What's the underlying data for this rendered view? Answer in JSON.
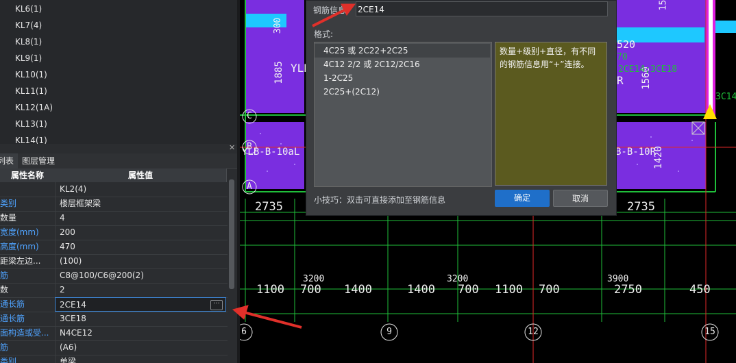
{
  "beam_list": [
    "KL6(1)",
    "KL7(4)",
    "KL8(1)",
    "KL9(1)",
    "KL10(1)",
    "KL11(1)",
    "KL12(1A)",
    "KL13(1)",
    "KL14(1)"
  ],
  "tabs": {
    "property_list": "属性列表",
    "layer_manage": "图层管理"
  },
  "props": {
    "header_name": "属性名称",
    "header_value": "属性值",
    "rows": [
      {
        "name": "名称",
        "value": "KL2(4)"
      },
      {
        "name": "结构类别",
        "value": "楼层框架梁"
      },
      {
        "name": "跨数量",
        "value": "4"
      },
      {
        "name": "截面宽度(mm)",
        "value": "200"
      },
      {
        "name": "截面高度(mm)",
        "value": "470"
      },
      {
        "name": "轴线距梁左边...",
        "value": "(100)"
      },
      {
        "name": "箍筋",
        "value": "C8@100/C6@200(2)"
      },
      {
        "name": "肢数",
        "value": "2"
      },
      {
        "name": "上部通长筋",
        "value": "2CE14"
      },
      {
        "name": "下部通长筋",
        "value": "3CE18"
      },
      {
        "name": "侧面构造或受...",
        "value": "N4CE12"
      },
      {
        "name": "拉筋",
        "value": "(A6)"
      },
      {
        "name": "定额类别",
        "value": "单梁"
      }
    ]
  },
  "dialog": {
    "rebar_label": "钢筋信息",
    "rebar_value": "2CE14",
    "format_label": "格式:",
    "formats": [
      "4C25 或 2C22+2C25",
      "4C12 2/2 或 2C12/2C16",
      "1-2C25",
      "2C25+(2C12)"
    ],
    "description": "数量+级别+直径，有不同的钢筋信息用“+”连接。",
    "tip": "小技巧：双击可直接添加至钢筋信息",
    "ok_label": "确定",
    "cancel_label": "取消"
  },
  "cad": {
    "dims_top": [
      "2735",
      "2735"
    ],
    "dims_lower": [
      "3200",
      "3200",
      "3900"
    ],
    "dims_bottom": [
      "1100",
      "700",
      "1400",
      "1400",
      "700",
      "1100",
      "700",
      "2750",
      "450"
    ],
    "axis_rows": [
      "C",
      "B",
      "A"
    ],
    "axis_cols": [
      "6",
      "9",
      "12",
      "15"
    ],
    "beam_texts": [
      "300",
      "1885",
      "YLB",
      "YLB-B-10aL",
      "B-B-10R",
      "1420",
      "1560",
      "520",
      "70",
      "2CE14;3CE18",
      "R",
      "3C14",
      "15"
    ]
  },
  "colors": {
    "accent": "#1f6fc9",
    "beam_fill": "#7a2ee0",
    "cad_grid": "#1fbf3a",
    "arrow": "#e0302a"
  }
}
